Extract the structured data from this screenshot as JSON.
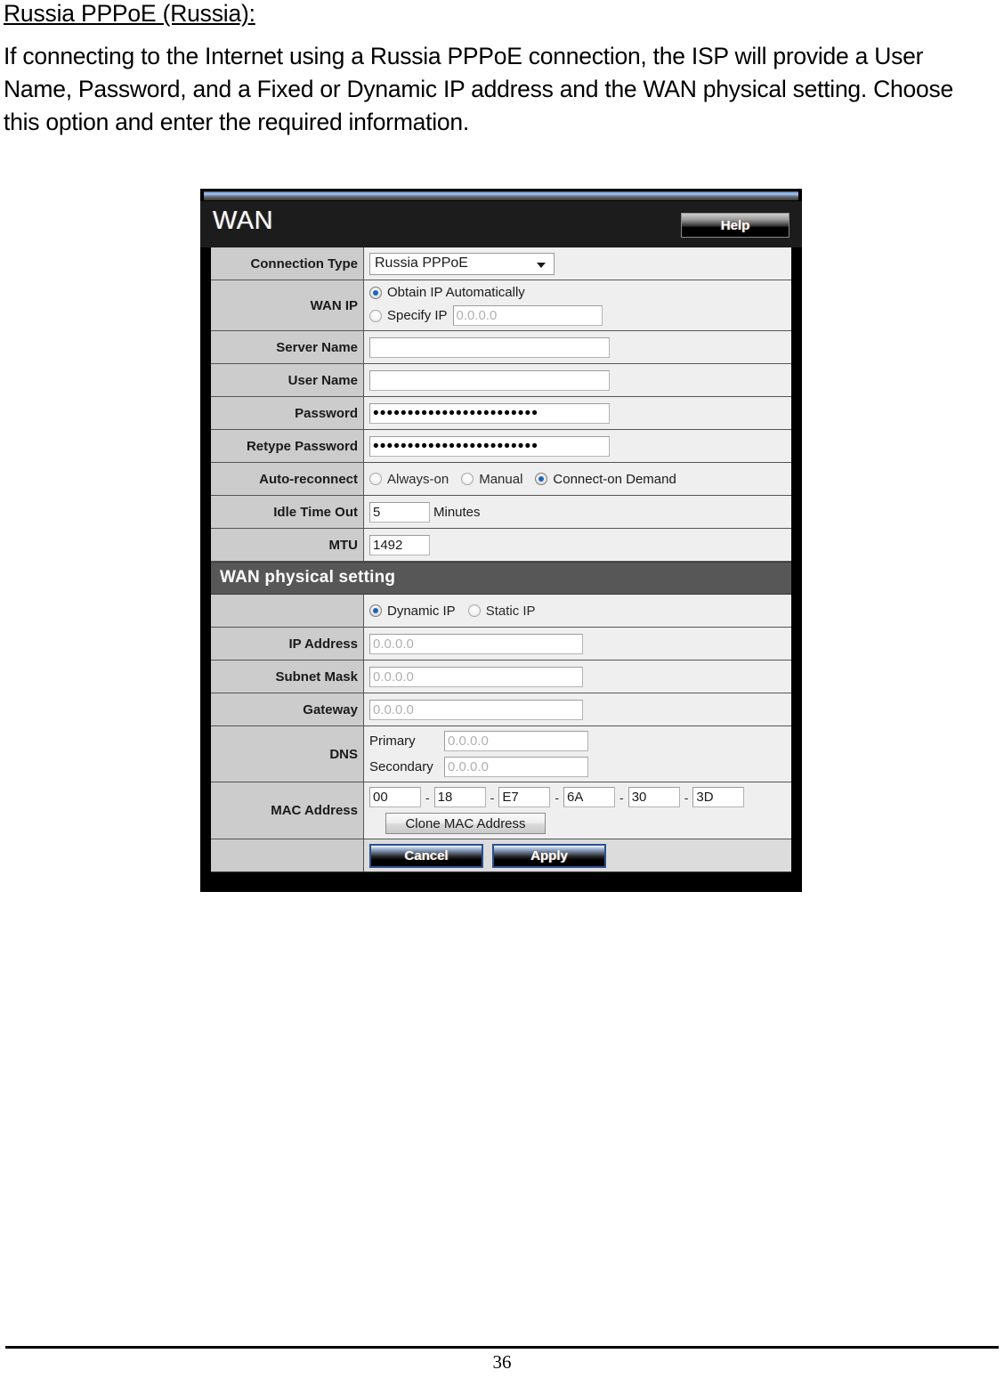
{
  "document": {
    "heading": "Russia PPPoE (Russia):",
    "paragraph": "If connecting to the Internet using a Russia PPPoE connection, the ISP will provide a User Name, Password, and a Fixed or Dynamic IP address and the WAN physical setting. Choose this option and enter the required information.",
    "page_number": "36"
  },
  "panel": {
    "title": "WAN",
    "help_label": "Help",
    "connection_type": {
      "label": "Connection Type",
      "selected": "Russia PPPoE"
    },
    "wan_ip": {
      "label": "WAN IP",
      "option_auto": "Obtain IP Automatically",
      "option_specify": "Specify IP",
      "specify_value": "0.0.0.0",
      "selected": "Obtain IP Automatically"
    },
    "server_name": {
      "label": "Server Name",
      "value": ""
    },
    "user_name": {
      "label": "User Name",
      "value": ""
    },
    "password": {
      "label": "Password",
      "masked": "••••••••••••••••••••••••"
    },
    "retype_password": {
      "label": "Retype Password",
      "masked": "••••••••••••••••••••••••"
    },
    "auto_reconnect": {
      "label": "Auto-reconnect",
      "option_always": "Always-on",
      "option_manual": "Manual",
      "option_demand": "Connect-on Demand",
      "selected": "Connect-on Demand"
    },
    "idle_time_out": {
      "label": "Idle Time Out",
      "value": "5",
      "unit": "Minutes"
    },
    "mtu": {
      "label": "MTU",
      "value": "1492"
    },
    "physical": {
      "section_title": "WAN physical setting",
      "mode": {
        "option_dynamic": "Dynamic IP",
        "option_static": "Static IP",
        "selected": "Dynamic IP"
      },
      "ip_address": {
        "label": "IP Address",
        "value": "0.0.0.0"
      },
      "subnet_mask": {
        "label": "Subnet Mask",
        "value": "0.0.0.0"
      },
      "gateway": {
        "label": "Gateway",
        "value": "0.0.0.0"
      },
      "dns": {
        "label": "DNS",
        "primary_label": "Primary",
        "primary_value": "0.0.0.0",
        "secondary_label": "Secondary",
        "secondary_value": "0.0.0.0"
      },
      "mac_address": {
        "label": "MAC Address",
        "octets": [
          "00",
          "18",
          "E7",
          "6A",
          "30",
          "3D"
        ],
        "separator": "-",
        "clone_label": "Clone MAC Address"
      }
    },
    "actions": {
      "cancel_label": "Cancel",
      "apply_label": "Apply"
    }
  },
  "colors": {
    "accent_blue": "#1f63b5",
    "section_bar": "#575757",
    "label_cell": "#cccccc",
    "field_bg": "#efefef"
  }
}
